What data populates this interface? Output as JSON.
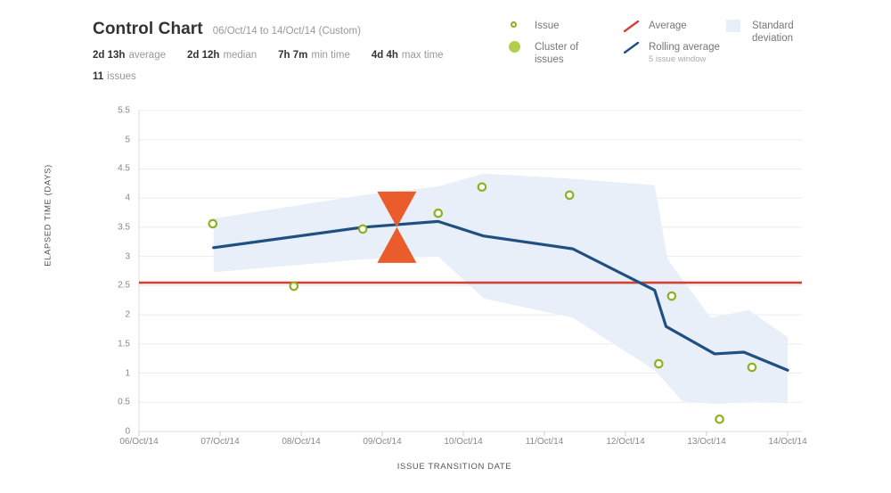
{
  "header": {
    "title": "Control Chart",
    "date_range": "06/Oct/14 to 14/Oct/14 (Custom)",
    "stats": [
      {
        "value": "2d 13h",
        "label": "average"
      },
      {
        "value": "2d 12h",
        "label": "median"
      },
      {
        "value": "7h 7m",
        "label": "min time"
      },
      {
        "value": "4d 4h",
        "label": "max time"
      }
    ],
    "issue_count": {
      "value": "11",
      "label": "issues"
    }
  },
  "legend": {
    "items": [
      {
        "id": "issue",
        "label": "Issue",
        "swatch": "ring-marker",
        "color": "#8eb021"
      },
      {
        "id": "cluster",
        "label": "Cluster of issues",
        "swatch": "filled-circle",
        "color": "#b2cf4b"
      },
      {
        "id": "average",
        "label": "Average",
        "swatch": "line",
        "color": "#d04437"
      },
      {
        "id": "rolling-average",
        "label": "Rolling average",
        "sublabel": "5 issue window",
        "swatch": "line",
        "color": "#205081"
      },
      {
        "id": "standard-deviation",
        "label": "Standard deviation",
        "swatch": "band",
        "color": "#e8eff8"
      }
    ]
  },
  "chart_data": {
    "type": "scatter",
    "title": "Control Chart",
    "xlabel": "ISSUE TRANSITION DATE",
    "ylabel": "ELAPSED TIME (DAYS)",
    "grid": true,
    "legend_position": "top-right",
    "xlim": [
      0,
      8
    ],
    "ylim": [
      0,
      5.5
    ],
    "x_tick_labels": [
      "06/Oct/14",
      "07/Oct/14",
      "08/Oct/14",
      "09/Oct/14",
      "10/Oct/14",
      "11/Oct/14",
      "12/Oct/14",
      "13/Oct/14",
      "14/Oct/14"
    ],
    "x_tick_values": [
      0,
      1,
      2,
      3,
      4,
      5,
      6,
      7,
      8
    ],
    "y_tick_labels": [
      "0",
      "0.5",
      "1",
      "1.5",
      "2",
      "2.5",
      "3",
      "3.5",
      "4",
      "4.5",
      "5",
      "5.5"
    ],
    "y_tick_values": [
      0,
      0.5,
      1,
      1.5,
      2,
      2.5,
      3,
      3.5,
      4,
      4.5,
      5,
      5.5
    ],
    "series": [
      {
        "name": "Issue",
        "type": "scatter",
        "color": "#8eb021",
        "points": [
          {
            "x": 0.91,
            "y": 3.56
          },
          {
            "x": 1.91,
            "y": 2.49
          },
          {
            "x": 2.76,
            "y": 3.47
          },
          {
            "x": 3.69,
            "y": 3.74
          },
          {
            "x": 4.23,
            "y": 4.19
          },
          {
            "x": 5.31,
            "y": 4.05
          },
          {
            "x": 6.57,
            "y": 2.32
          },
          {
            "x": 6.41,
            "y": 1.16
          },
          {
            "x": 7.16,
            "y": 0.21
          },
          {
            "x": 7.56,
            "y": 1.1
          }
        ]
      },
      {
        "name": "Average",
        "type": "line",
        "color": "#d04437",
        "value": 2.55
      },
      {
        "name": "Rolling average",
        "type": "line",
        "color": "#205081",
        "points": [
          {
            "x": 0.92,
            "y": 3.15
          },
          {
            "x": 2.76,
            "y": 3.5
          },
          {
            "x": 3.69,
            "y": 3.6
          },
          {
            "x": 4.25,
            "y": 3.35
          },
          {
            "x": 5.35,
            "y": 3.13
          },
          {
            "x": 6.36,
            "y": 2.42
          },
          {
            "x": 6.5,
            "y": 1.8
          },
          {
            "x": 7.1,
            "y": 1.33
          },
          {
            "x": 7.46,
            "y": 1.36
          },
          {
            "x": 8.0,
            "y": 1.05
          }
        ]
      },
      {
        "name": "Standard deviation",
        "type": "band",
        "color": "#e8eff8",
        "upper": [
          {
            "x": 0.92,
            "y": 3.65
          },
          {
            "x": 2.76,
            "y": 4.05
          },
          {
            "x": 3.69,
            "y": 4.2
          },
          {
            "x": 4.25,
            "y": 4.42
          },
          {
            "x": 5.35,
            "y": 4.33
          },
          {
            "x": 6.36,
            "y": 4.22
          },
          {
            "x": 6.52,
            "y": 2.95
          },
          {
            "x": 7.05,
            "y": 1.95
          },
          {
            "x": 7.52,
            "y": 2.08
          },
          {
            "x": 8.0,
            "y": 1.62
          }
        ],
        "lower": [
          {
            "x": 0.92,
            "y": 2.73
          },
          {
            "x": 2.76,
            "y": 2.95
          },
          {
            "x": 3.69,
            "y": 3.0
          },
          {
            "x": 4.25,
            "y": 2.28
          },
          {
            "x": 5.35,
            "y": 1.95
          },
          {
            "x": 6.36,
            "y": 1.05
          },
          {
            "x": 6.7,
            "y": 0.52
          },
          {
            "x": 7.12,
            "y": 0.47
          },
          {
            "x": 7.6,
            "y": 0.52
          },
          {
            "x": 8.0,
            "y": 0.48
          }
        ]
      }
    ],
    "cursor_marker": {
      "x": 3.18,
      "y": 3.5,
      "color": "#ea5c2b",
      "shape": "hourglass"
    }
  }
}
